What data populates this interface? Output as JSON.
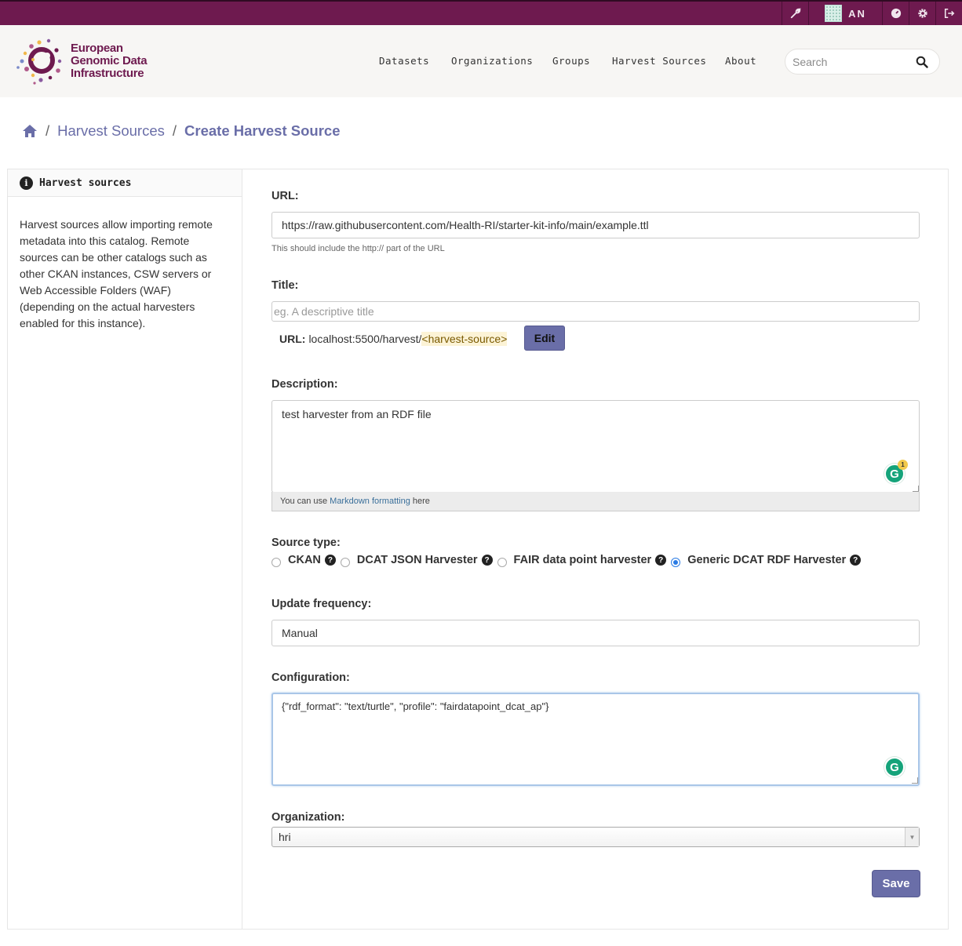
{
  "account": {
    "sysadmin_icon": "wrench-icon",
    "user_initials": "AN",
    "dashboard_icon": "dashboard-icon",
    "settings_icon": "gear-icon",
    "logout_icon": "logout-icon"
  },
  "brand": {
    "line1": "European",
    "line2": "Genomic Data",
    "line3": "Infrastructure",
    "color": "#6e1a4f"
  },
  "nav": {
    "datasets": "Datasets",
    "organizations": "Organizations",
    "groups": "Groups",
    "harvest_sources": "Harvest Sources",
    "about": "About"
  },
  "search": {
    "placeholder": "Search"
  },
  "breadcrumb": {
    "home_icon": "home-icon",
    "sep": "/",
    "item1": "Harvest Sources",
    "item2": "Create Harvest Source"
  },
  "sidebar": {
    "heading": "Harvest sources",
    "text": "Harvest sources allow importing remote metadata into this catalog. Remote sources can be other catalogs such as other CKAN instances, CSW servers or Web Accessible Folders (WAF) (depending on the actual harvesters enabled for this instance)."
  },
  "form": {
    "url_label": "URL:",
    "url_value": "https://raw.githubusercontent.com/Health-RI/starter-kit-info/main/example.ttl",
    "url_help": "This should include the http:// part of the URL",
    "title_label": "Title:",
    "title_placeholder": "eg. A descriptive title",
    "slug_label": "URL:",
    "slug_prefix": "localhost:5500/harvest/",
    "slug_value": "<harvest-source>",
    "edit_button": "Edit",
    "description_label": "Description:",
    "description_value": "test harvester from an RDF file",
    "markdown_pre": "You can use",
    "markdown_link": "Markdown formatting",
    "markdown_post": "here",
    "grammarly_count": "1",
    "source_type_label": "Source type:",
    "source_types": [
      {
        "label": "CKAN",
        "selected": false
      },
      {
        "label": "DCAT JSON Harvester",
        "selected": false
      },
      {
        "label": "FAIR data point harvester",
        "selected": false
      },
      {
        "label": "Generic DCAT RDF Harvester",
        "selected": true
      }
    ],
    "frequency_label": "Update frequency:",
    "frequency_value": "Manual",
    "config_label": "Configuration:",
    "config_value": "{\"rdf_format\": \"text/turtle\", \"profile\": \"fairdatapoint_dcat_ap\"}",
    "organization_label": "Organization:",
    "organization_value": "hri",
    "save_button": "Save"
  },
  "colors": {
    "topbar": "#6e1a4f",
    "accent": "#6a6ea8",
    "masthead": "#f7f6f4"
  }
}
